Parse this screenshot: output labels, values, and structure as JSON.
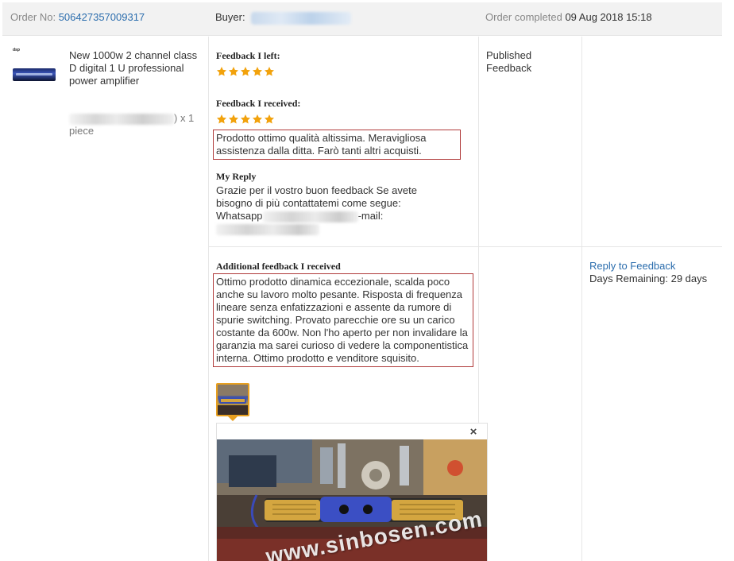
{
  "order": {
    "number_label": "Order No:",
    "number": "506427357009317",
    "buyer_label": "Buyer:",
    "status_label": "Order completed",
    "completed_date": "09 Aug 2018 15:18"
  },
  "product": {
    "thumbnail_label": "dsp",
    "title": "New 1000w 2 channel class D digital 1 U professional power amplifier",
    "quantity_suffix": ") x 1 piece"
  },
  "feedback": {
    "left_label": "Feedback I left:",
    "left_rating": 5,
    "received_label": "Feedback I received:",
    "received_rating": 5,
    "received_text": "Prodotto ottimo qualità altissima. Meravigliosa assistenza dalla ditta. Farò tanti altri acquisti.",
    "reply_label": "My Reply",
    "reply_text_line1": "Grazie per il vostro buon feedback Se avete bisogno di più  contattatemi come segue:",
    "reply_whatsapp": "Whatsapp",
    "reply_email": "-mail:",
    "status": "Published Feedback",
    "additional_label": "Additional feedback I received",
    "additional_text": "Ottimo prodotto dinamica eccezionale, scalda poco anche su lavoro molto pesante. Risposta di frequenza lineare senza enfatizzazioni e assente da rumore di spurie switching. Provato parecchie ore su un carico costante da 600w. Non l'ho aperto per non invalidare la garanzia ma sarei curioso di vedere la componentistica interna. Ottimo prodotto e venditore squisito."
  },
  "actions": {
    "reply_link": "Reply to Feedback",
    "days_remaining": "Days Remaining: 29 days"
  },
  "preview": {
    "close_glyph": "×",
    "watermark": "www.sinbosen.com"
  },
  "colors": {
    "link": "#2b6dad",
    "star": "#f2a20c",
    "box_border": "#b03a3a",
    "header_bg": "#f2f2f2",
    "thumb_border": "#e8a020"
  }
}
